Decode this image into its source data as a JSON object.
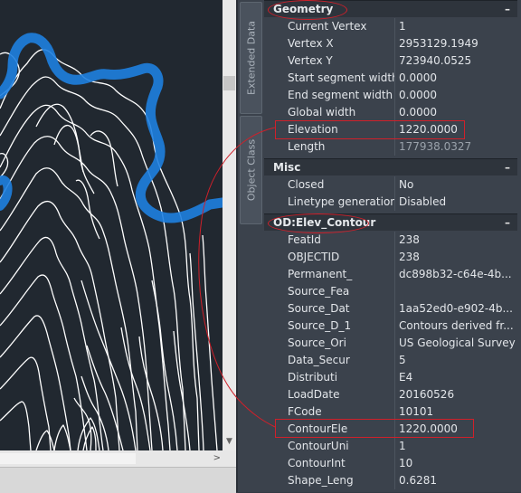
{
  "side_tabs": {
    "extended_data": "Extended Data",
    "object_class": "Object Class"
  },
  "sections": {
    "geometry": {
      "title": "Geometry",
      "toggle": "–"
    },
    "misc": {
      "title": "Misc",
      "toggle": "–"
    },
    "od": {
      "title": "OD:Elev_Contour",
      "toggle": "–"
    }
  },
  "geometry_rows": [
    {
      "label": "Current Vertex",
      "value": "1"
    },
    {
      "label": "Vertex X",
      "value": "2953129.1949"
    },
    {
      "label": "Vertex Y",
      "value": "723940.0525"
    },
    {
      "label": "Start segment width",
      "value": "0.0000"
    },
    {
      "label": "End segment width",
      "value": "0.0000"
    },
    {
      "label": "Global width",
      "value": "0.0000"
    },
    {
      "label": "Elevation",
      "value": "1220.0000"
    },
    {
      "label": "Length",
      "value": "177938.0327"
    }
  ],
  "misc_rows": [
    {
      "label": "Closed",
      "value": "No"
    },
    {
      "label": "Linetype generation",
      "value": "Disabled"
    }
  ],
  "od_rows": [
    {
      "label": "FeatId",
      "value": "238"
    },
    {
      "label": "OBJECTID",
      "value": "238"
    },
    {
      "label": "Permanent_",
      "value": "dc898b32-c64e-4b..."
    },
    {
      "label": "Source_Fea",
      "value": ""
    },
    {
      "label": "Source_Dat",
      "value": "1aa52ed0-e902-4b..."
    },
    {
      "label": "Source_D_1",
      "value": "Contours derived fr..."
    },
    {
      "label": "Source_Ori",
      "value": "US Geological Survey"
    },
    {
      "label": "Data_Secur",
      "value": "5"
    },
    {
      "label": "Distributi",
      "value": "E4"
    },
    {
      "label": "LoadDate",
      "value": "20160526"
    },
    {
      "label": "FCode",
      "value": "10101"
    },
    {
      "label": "ContourEle",
      "value": "1220.0000"
    },
    {
      "label": "ContourUni",
      "value": "1"
    },
    {
      "label": "ContourInt",
      "value": "10"
    },
    {
      "label": "Shape_Leng",
      "value": "0.6281"
    }
  ],
  "colors": {
    "canvas_bg": "#212830",
    "contour_line": "#ffffff",
    "selection_grip": "#1e7fe0",
    "annotation_red": "#d0202a"
  }
}
